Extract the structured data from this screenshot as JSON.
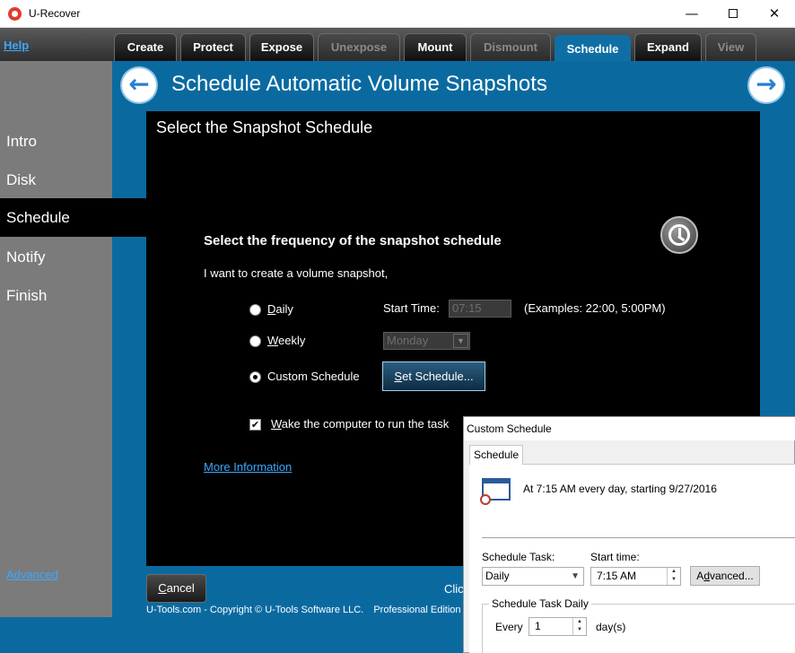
{
  "window": {
    "title": "U-Recover",
    "min_glyph": "—",
    "close_glyph": "✕"
  },
  "toolbar": {
    "help_label": "Help",
    "tabs": [
      {
        "label": "Create",
        "state": "enabled"
      },
      {
        "label": "Protect",
        "state": "enabled"
      },
      {
        "label": "Expose",
        "state": "enabled"
      },
      {
        "label": "Unexpose",
        "state": "disabled"
      },
      {
        "label": "Mount",
        "state": "enabled"
      },
      {
        "label": "Dismount",
        "state": "disabled"
      },
      {
        "label": "Schedule",
        "state": "active"
      },
      {
        "label": "Expand",
        "state": "enabled"
      },
      {
        "label": "View",
        "state": "disabled"
      }
    ]
  },
  "sidebar": {
    "items": [
      {
        "label": "Intro"
      },
      {
        "label": "Disk"
      },
      {
        "label": "Schedule",
        "active": true
      },
      {
        "label": "Notify"
      },
      {
        "label": "Finish"
      }
    ],
    "advanced_label": "Advanced"
  },
  "header": {
    "title": "Schedule Automatic Volume Snapshots",
    "back_glyph": "←",
    "next_glyph": "→"
  },
  "panel": {
    "title": "Select the Snapshot Schedule",
    "frequency_heading": "Select the frequency of the snapshot schedule",
    "intro_text": "I want to create a volume snapshot,",
    "options": {
      "daily_first": "D",
      "daily_rest": "aily",
      "weekly_first": "W",
      "weekly_rest": "eekly",
      "custom": "Custom Schedule",
      "selected": "custom"
    },
    "start_time_label": "Start Time:",
    "start_time_value": "07:15",
    "examples": "(Examples: 22:00, 5:00PM)",
    "weekday_value": "Monday",
    "set_schedule_first": "S",
    "set_schedule_rest": "et Schedule...",
    "wake_first": "W",
    "wake_rest": "ake the computer to run the task",
    "wake_checked": true,
    "more_info": "More Information"
  },
  "footer": {
    "cancel_first": "C",
    "cancel_rest": "ancel",
    "click_text": "Clic",
    "copyright": "U-Tools.com - Copyright © U-Tools Software LLC.",
    "edition": "Professional Edition"
  },
  "dialog": {
    "title": "Custom Schedule",
    "tab": "Schedule",
    "summary": "At 7:15 AM every day, starting 9/27/2016",
    "schedule_task_label": "Schedule Task:",
    "schedule_task_value": "Daily",
    "start_time_label": "Start time:",
    "start_time_value": "7:15 AM",
    "advanced_first": "A",
    "advanced_mid": "d",
    "advanced_rest": "vanced...",
    "group_label": "Schedule Task Daily",
    "every_label": "Every",
    "every_value": "1",
    "days_label": "day(s)"
  },
  "colors": {
    "accent_blue": "#0a6aa0",
    "link_blue": "#3da8ff",
    "sidebar_gray": "#7b7b7b",
    "panel_black": "#000000"
  }
}
